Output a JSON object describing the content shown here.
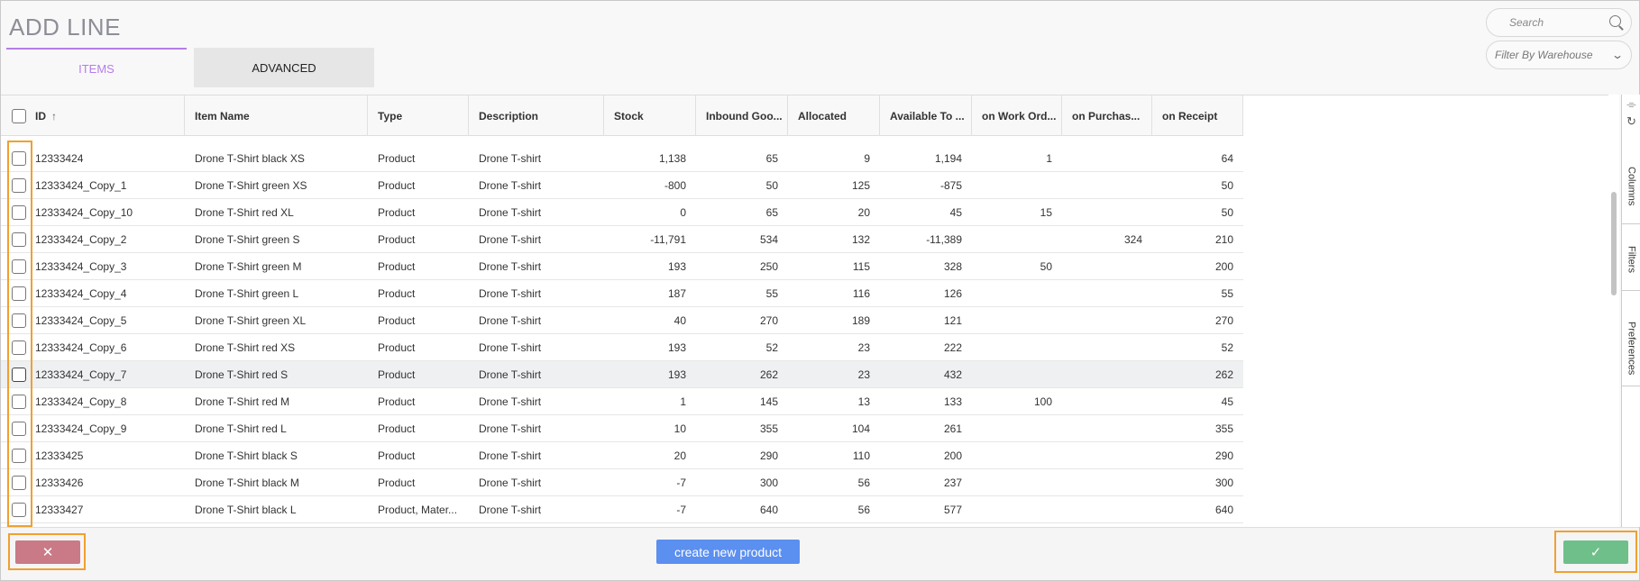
{
  "header": {
    "title": "ADD LINE",
    "tabs": [
      {
        "label": "ITEMS",
        "active": true
      },
      {
        "label": "ADVANCED",
        "active": false
      }
    ],
    "search_placeholder": "Search",
    "warehouse_filter_placeholder": "Filter By Warehouse"
  },
  "grid": {
    "columns": [
      {
        "label": "ID",
        "sort": "ascending"
      },
      {
        "label": "Item Name"
      },
      {
        "label": "Type"
      },
      {
        "label": "Description"
      },
      {
        "label": "Stock"
      },
      {
        "label": "Inbound Goo..."
      },
      {
        "label": "Allocated"
      },
      {
        "label": "Available To ..."
      },
      {
        "label": "on Work Ord..."
      },
      {
        "label": "on Purchas..."
      },
      {
        "label": "on Receipt"
      }
    ],
    "rows": [
      [
        "12333424",
        "Drone T-Shirt black XS",
        "Product",
        "Drone T-shirt",
        "1,138",
        "65",
        "9",
        "1,194",
        "1",
        "",
        "64"
      ],
      [
        "12333424_Copy_1",
        "Drone T-Shirt green XS",
        "Product",
        "Drone T-shirt",
        "-800",
        "50",
        "125",
        "-875",
        "",
        "",
        "50"
      ],
      [
        "12333424_Copy_10",
        "Drone T-Shirt red XL",
        "Product",
        "Drone T-shirt",
        "0",
        "65",
        "20",
        "45",
        "15",
        "",
        "50"
      ],
      [
        "12333424_Copy_2",
        "Drone T-Shirt green S",
        "Product",
        "Drone T-shirt",
        "-11,791",
        "534",
        "132",
        "-11,389",
        "",
        "324",
        "210"
      ],
      [
        "12333424_Copy_3",
        "Drone T-Shirt green M",
        "Product",
        "Drone T-shirt",
        "193",
        "250",
        "115",
        "328",
        "50",
        "",
        "200"
      ],
      [
        "12333424_Copy_4",
        "Drone T-Shirt green L",
        "Product",
        "Drone T-shirt",
        "187",
        "55",
        "116",
        "126",
        "",
        "",
        "55"
      ],
      [
        "12333424_Copy_5",
        "Drone T-Shirt green XL",
        "Product",
        "Drone T-shirt",
        "40",
        "270",
        "189",
        "121",
        "",
        "",
        "270"
      ],
      [
        "12333424_Copy_6",
        "Drone T-Shirt red XS",
        "Product",
        "Drone T-shirt",
        "193",
        "52",
        "23",
        "222",
        "",
        "",
        "52"
      ],
      [
        "12333424_Copy_7",
        "Drone T-Shirt red S",
        "Product",
        "Drone T-shirt",
        "193",
        "262",
        "23",
        "432",
        "",
        "",
        "262"
      ],
      [
        "12333424_Copy_8",
        "Drone T-Shirt red M",
        "Product",
        "Drone T-shirt",
        "1",
        "145",
        "13",
        "133",
        "100",
        "",
        "45"
      ],
      [
        "12333424_Copy_9",
        "Drone T-Shirt red L",
        "Product",
        "Drone T-shirt",
        "10",
        "355",
        "104",
        "261",
        "",
        "",
        "355"
      ],
      [
        "12333425",
        "Drone T-Shirt black S",
        "Product",
        "Drone T-shirt",
        "20",
        "290",
        "110",
        "200",
        "",
        "",
        "290"
      ],
      [
        "12333426",
        "Drone T-Shirt black M",
        "Product",
        "Drone T-shirt",
        "-7",
        "300",
        "56",
        "237",
        "",
        "",
        "300"
      ],
      [
        "12333427",
        "Drone T-Shirt black L",
        "Product, Mater...",
        "Drone T-shirt",
        "-7",
        "640",
        "56",
        "577",
        "",
        "",
        "640"
      ]
    ],
    "hovered_row": 8
  },
  "side_panel": {
    "tabs": [
      "Columns",
      "Filters",
      "Preferences"
    ],
    "icons": [
      "filter-off-icon",
      "refresh-icon"
    ]
  },
  "footer": {
    "cancel_label": "✕",
    "create_label": "create new product",
    "confirm_label": "✓"
  },
  "colors": {
    "accent_tab": "#b57ee8",
    "cancel": "#c97a86",
    "create": "#5b8ff0",
    "confirm": "#6fbf8a",
    "highlight": "#f0a030"
  }
}
